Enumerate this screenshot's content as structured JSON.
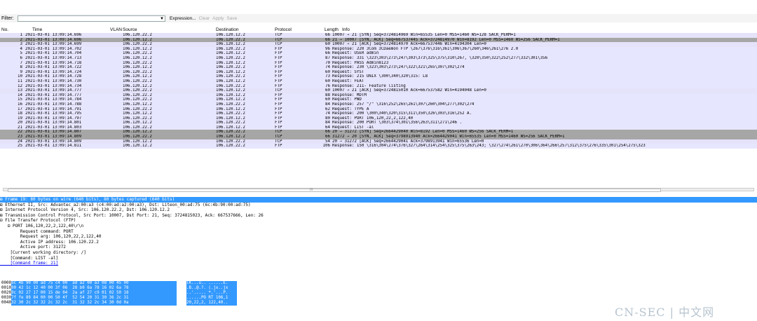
{
  "filter": {
    "label": "Filter:",
    "value": "",
    "dropdown_glyph": "▼",
    "expression_label": "Expression...",
    "clear_label": "Clear",
    "apply_label": "Apply",
    "save_label": "Save"
  },
  "columns": {
    "no": "No.",
    "time": "Time",
    "vlan": "VLAN",
    "source": "Source",
    "destination": "Destination",
    "protocol": "Protocol",
    "length": "Length",
    "info": "Info"
  },
  "packets": [
    {
      "no": "1",
      "time": "2021-03-01 13:09:14.696",
      "src": "106.120.22.2",
      "dst": "106.120.12.2",
      "proto": "TCP",
      "len": "66",
      "info": "10007 → 21 [SYN] Seq=3724814969 Win=65535 Len=0 MSS=1460 WS=128 SACK_PERM=1",
      "style": "tcp"
    },
    {
      "no": "2",
      "time": "2021-03-01 13:09:14.696",
      "src": "106.120.12.2",
      "dst": "106.120.22.2",
      "proto": "TCP",
      "len": "66",
      "info": "21 → 10007 [SYN, ACK] Seq=667537445 Ack=3724814970 Win=8192 Len=0 MSS=1460 WS=256 SACK_PERM=1",
      "style": "sel"
    },
    {
      "no": "3",
      "time": "2021-03-01 13:09:14.699",
      "src": "106.120.22.2",
      "dst": "106.120.12.2",
      "proto": "TCP",
      "len": "60",
      "info": "10007 → 21 [ACK] Seq=3724814970 Ack=667537446 Win=4194304 Len=0",
      "style": "tcp"
    },
    {
      "no": "4",
      "time": "2021-03-01 13:09:14.702",
      "src": "106.120.12.2",
      "dst": "106.120.22.2",
      "proto": "FTP",
      "len": "96",
      "info": "Response: 220 3Com 3CDaemon FTP \\267\\376\\316\\361\\306\\367\\260\\346\\261\\276 2.0",
      "style": "ftp"
    },
    {
      "no": "5",
      "time": "2021-03-01 13:09:14.704",
      "src": "106.120.22.2",
      "dst": "106.120.12.2",
      "proto": "FTP",
      "len": "66",
      "info": "Request: USER admin",
      "style": "ftp"
    },
    {
      "no": "6",
      "time": "2021-03-01 13:09:14.713",
      "src": "106.120.12.2",
      "dst": "106.120.22.2",
      "proto": "FTP",
      "len": "87",
      "info": "Response: 331 \\323\\303\\273\\247\\303\\373\\325\\375\\310\\267, \\320\\350\\322\\252\\277\\332\\301\\356",
      "style": "ftp"
    },
    {
      "no": "7",
      "time": "2021-03-01 13:09:14.718",
      "src": "106.120.22.2",
      "dst": "106.120.12.2",
      "proto": "FTP",
      "len": "70",
      "info": "Request: PASS Admin8123",
      "style": "ftp"
    },
    {
      "no": "8",
      "time": "2021-03-01 13:09:14.722",
      "src": "106.120.12.2",
      "dst": "106.120.22.2",
      "proto": "FTP",
      "len": "74",
      "info": "Response: 230 \\323\\303\\273\\247\\322\\321\\265\\307\\302\\274",
      "style": "ftp"
    },
    {
      "no": "9",
      "time": "2021-03-01 13:09:14.724",
      "src": "106.120.22.2",
      "dst": "106.120.12.2",
      "proto": "FTP",
      "len": "60",
      "info": "Request: SYST",
      "style": "ftp"
    },
    {
      "no": "10",
      "time": "2021-03-01 13:09:14.728",
      "src": "106.120.12.2",
      "dst": "106.120.22.2",
      "proto": "FTP",
      "len": "73",
      "info": "Response: 215 UNIX \\300\\340\\320\\315: L8",
      "style": "ftp"
    },
    {
      "no": "11",
      "time": "2021-03-01 13:09:14.730",
      "src": "106.120.22.2",
      "dst": "106.120.12.2",
      "proto": "FTP",
      "len": "60",
      "info": "Request: FEAT",
      "style": "ftp"
    },
    {
      "no": "12",
      "time": "2021-03-01 13:09:14.734",
      "src": "106.120.12.2",
      "dst": "106.120.22.2",
      "proto": "FTP",
      "len": "76",
      "info": "Response: 211- Feature listing",
      "style": "ftp"
    },
    {
      "no": "13",
      "time": "2021-03-01 13:09:14.777",
      "src": "106.120.22.2",
      "dst": "106.120.12.2",
      "proto": "TCP",
      "len": "60",
      "info": "10007 → 21 [ACK] Seq=3724815010 Ack=667537582 Win=4194048 Len=0",
      "style": "tcp"
    },
    {
      "no": "14",
      "time": "2021-03-01 13:09:14.777",
      "src": "106.120.22.2",
      "dst": "106.120.12.2",
      "proto": "FTP",
      "len": "88",
      "info": "Response: MDTM",
      "style": "ftp"
    },
    {
      "no": "15",
      "time": "2021-03-01 13:09:14.784",
      "src": "106.120.22.2",
      "dst": "106.120.12.2",
      "proto": "FTP",
      "len": "60",
      "info": "Request: PWD",
      "style": "ftp"
    },
    {
      "no": "16",
      "time": "2021-03-01 13:09:14.788",
      "src": "106.120.12.2",
      "dst": "106.120.22.2",
      "proto": "FTP",
      "len": "84",
      "info": "Response: 257 \"/\" \\316\\252\\265\\261\\307\\260\\304\\277\\302\\274",
      "style": "ftp"
    },
    {
      "no": "17",
      "time": "2021-03-01 13:09:14.791",
      "src": "106.120.22.2",
      "dst": "106.120.12.2",
      "proto": "FTP",
      "len": "62",
      "info": "Request: TYPE A",
      "style": "ftp"
    },
    {
      "no": "18",
      "time": "2021-03-01 13:09:14.795",
      "src": "106.120.12.2",
      "dst": "106.120.22.2",
      "proto": "FTP",
      "len": "74",
      "info": "Response: 200 \\300\\340\\320\\315\\311\\350\\326\\303\\316\\252 A.",
      "style": "ftp"
    },
    {
      "no": "19",
      "time": "2021-03-01 13:09:14.797",
      "src": "106.120.22.2",
      "dst": "106.120.12.2",
      "proto": "FTP",
      "len": "80",
      "info": "Request: PORT 106,120,22,2,122,40",
      "style": "ftp"
    },
    {
      "no": "20",
      "time": "2021-03-01 13:09:14.801",
      "src": "106.120.12.2",
      "dst": "106.120.22.2",
      "proto": "FTP",
      "len": "84",
      "info": "Response: 200 PORT \\303\\374\\301\\356\\263\\311\\271\\246                .",
      "style": "ftp"
    },
    {
      "no": "21",
      "time": "2021-03-01 13:09:14.803",
      "src": "106.120.22.2",
      "dst": "106.120.12.2",
      "proto": "FTP",
      "len": "64",
      "info": "Request: LIST -al",
      "style": "ftp"
    },
    {
      "no": "22",
      "time": "2021-03-01 13:09:14.807",
      "src": "106.120.12.2",
      "dst": "106.120.22.2",
      "proto": "TCP",
      "len": "66",
      "info": "20 → 31272 [SYN] Seq=2664429040 Win=8192 Len=0 MSS=1460 WS=256 SACK_PERM=1",
      "style": "sel"
    },
    {
      "no": "23",
      "time": "2021-03-01 13:09:14.809",
      "src": "106.120.22.2",
      "dst": "106.120.12.2",
      "proto": "TCP",
      "len": "66",
      "info": "31272 → 20 [SYN, ACK] Seq=3798913940 Ack=2664429041 Win=65535 Len=0 MSS=1460 WS=256 SACK_PERM=1",
      "style": "sel"
    },
    {
      "no": "24",
      "time": "2021-03-01 13:09:14.809",
      "src": "106.120.12.2",
      "dst": "106.120.22.2",
      "proto": "TCP",
      "len": "54",
      "info": "20 → 31272 [ACK] Seq=2664429041 Ack=3798913941 Win=65536 Len=0",
      "style": "tcp"
    },
    {
      "no": "25",
      "time": "2021-03-01 13:09:14.811",
      "src": "106.120.12.2",
      "dst": "106.120.22.2",
      "proto": "FTP",
      "len": "106",
      "info": "Response: 150 \\316\\304\\274\\376\\327\\264\\314\\254\\325\\375\\263\\243; \\327\\274\\261\\270\\306\\364\\266\\257\\312\\375\\276\\335\\301\\254\\275\\323",
      "style": "ftp"
    }
  ],
  "hscroll_mark": "III",
  "details": [
    {
      "text": "⊞ Frame 19: 80 bytes on wire (640 bits), 80 bytes captured (640 bits)",
      "style": "hl"
    },
    {
      "text": "⊞ Ethernet II, Src: Advantec_a2:00:a3 (c4:00:ad:a2:00:a3), Dst: Liteon_00:ad:75 (6c:4b:90:00:ad:75)",
      "style": ""
    },
    {
      "text": "⊞ Internet Protocol Version 4, Src: 106.120.22.2, Dst: 106.120.12.2",
      "style": ""
    },
    {
      "text": "⊞ Transmission Control Protocol, Src Port: 10007, Dst Port: 21, Seq: 3724815023, Ack: 667537666, Len: 26",
      "style": ""
    },
    {
      "text": "⊟ File Transfer Protocol (FTP)",
      "style": ""
    },
    {
      "text": "   ⊟ PORT 106,120,22,2,122,40\\r\\n",
      "style": ""
    },
    {
      "text": "        Request command: PORT",
      "style": ""
    },
    {
      "text": "        Request arg: 106,120,22,2,122,40",
      "style": ""
    },
    {
      "text": "        Active IP address: 106.120.22.2",
      "style": ""
    },
    {
      "text": "        Active port: 31272",
      "style": ""
    },
    {
      "text": "    [Current working directory: /]",
      "style": ""
    },
    {
      "text": "    [Command: LIST -al]",
      "style": ""
    },
    {
      "text": "    [Command frame: 21]",
      "style": "lnk"
    }
  ],
  "hex": [
    {
      "off": "0000",
      "bytes": "6c 4b 90 00 ad 75 c4 00  ad a2 00 a3 08 00 45 00",
      "ascii": "lK...u.. ......E."
    },
    {
      "off": "0010",
      "bytes": "00 42 1c 12 40 00 3f 06  28 b0 6a 78 16 02 6a 78",
      "ascii": ".B..@.?. (.jx..jx"
    },
    {
      "off": "0020",
      "bytes": "0c 02 27 17 00 15 de 04  2a af 27 c9 01 02 50 18",
      "ascii": "..'..... *.'...P."
    },
    {
      "off": "0030",
      "bytes": "7f fe 89 84 00 00 50 4f  52 54 20 31 30 36 2c 31",
      "ascii": "......PO RT 106,1"
    },
    {
      "off": "0040",
      "bytes": "32 30 2c 32 32 2c 32 2c  31 32 32 2c 34 30 0d 0a",
      "ascii": "20,22,2, 122,40.."
    }
  ],
  "watermark": "CN-SEC | 中文网",
  "colors": {
    "tcp_row": "#e4e3fa",
    "ftp_row": "#e7e6ff",
    "selected_row": "#a6a6a6",
    "highlight": "#3399ff"
  }
}
